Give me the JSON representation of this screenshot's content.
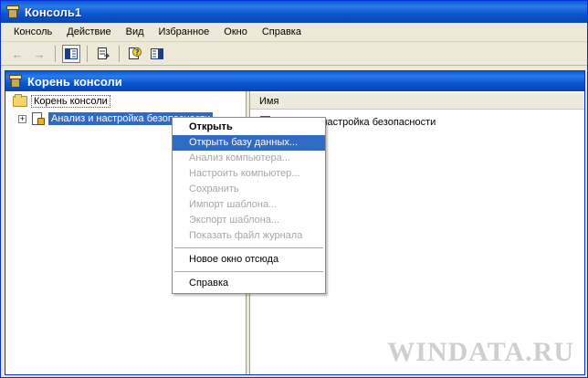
{
  "window": {
    "title": "Консоль1"
  },
  "menubar": {
    "items": [
      {
        "label": "Консоль"
      },
      {
        "label": "Действие"
      },
      {
        "label": "Вид"
      },
      {
        "label": "Избранное"
      },
      {
        "label": "Окно"
      },
      {
        "label": "Справка"
      }
    ]
  },
  "toolbar": {
    "buttons": [
      {
        "icon": "back-arrow-icon"
      },
      {
        "icon": "forward-arrow-icon"
      },
      {
        "icon": "show-hide-console-tree-icon"
      },
      {
        "icon": "export-list-icon"
      },
      {
        "icon": "help-icon"
      },
      {
        "icon": "show-hide-action-pane-icon"
      }
    ]
  },
  "child_window": {
    "title": "Корень консоли"
  },
  "tree": {
    "root_label": "Корень консоли",
    "child_label": "Анализ и настройка безопасности"
  },
  "list": {
    "column_name": "Имя",
    "row_label": "Анализ и настройка безопасности"
  },
  "context_menu": {
    "items": [
      {
        "label": "Открыть",
        "state": "default"
      },
      {
        "label": "Открыть базу данных...",
        "state": "highlighted"
      },
      {
        "label": "Анализ компьютера...",
        "state": "disabled"
      },
      {
        "label": "Настроить компьютер...",
        "state": "disabled"
      },
      {
        "label": "Сохранить",
        "state": "disabled"
      },
      {
        "label": "Импорт шаблона...",
        "state": "disabled"
      },
      {
        "label": "Экспорт шаблона...",
        "state": "disabled"
      },
      {
        "label": "Показать файл журнала",
        "state": "disabled"
      },
      {
        "label": "Новое окно отсюда",
        "state": "normal"
      },
      {
        "label": "Справка",
        "state": "normal"
      }
    ]
  },
  "watermark": {
    "text": "WINDATA.RU"
  },
  "colors": {
    "titlebar": "#0a56d0",
    "selection": "#316ac5",
    "disabled_text": "#a6a6a6"
  }
}
